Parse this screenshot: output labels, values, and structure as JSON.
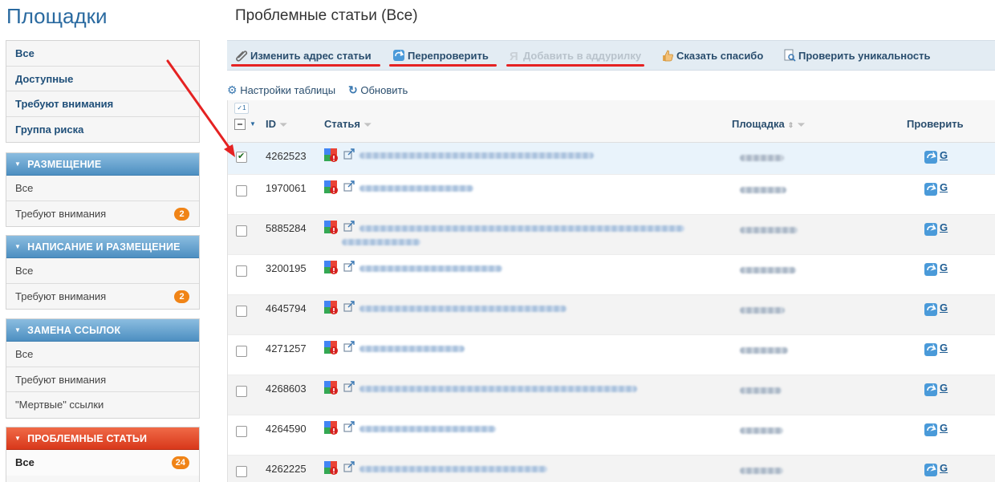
{
  "sidebar": {
    "title": "Площадки",
    "top_items": [
      "Все",
      "Доступные",
      "Требуют внимания",
      "Группа риска"
    ],
    "sections": [
      {
        "title": "РАЗМЕЩЕНИЕ",
        "color": "#5b9ccc",
        "items": [
          {
            "label": "Все"
          },
          {
            "label": "Требуют внимания",
            "badge": "2"
          }
        ]
      },
      {
        "title": "НАПИСАНИЕ И РАЗМЕЩЕНИЕ",
        "color": "#5b9ccc",
        "items": [
          {
            "label": "Все"
          },
          {
            "label": "Требуют внимания",
            "badge": "2"
          }
        ]
      },
      {
        "title": "ЗАМЕНА ССЫЛОК",
        "color": "#5b9ccc",
        "items": [
          {
            "label": "Все"
          },
          {
            "label": "Требуют внимания"
          },
          {
            "label": "\"Мертвые\" ссылки"
          }
        ]
      },
      {
        "title": "ПРОБЛЕМНЫЕ СТАТЬИ",
        "color": "#e04a2a",
        "items": [
          {
            "label": "Все",
            "badge": "24"
          }
        ]
      }
    ]
  },
  "main": {
    "title": "Проблемные статьи (Все)",
    "toolbar": {
      "change_url": "Изменить адрес статьи",
      "recheck": "Перепроверить",
      "add_addurilka": "Добавить в аддурилку",
      "say_thanks": "Сказать спасибо",
      "check_uniqueness": "Проверить уникальность"
    },
    "table_settings": "Настройки таблицы",
    "refresh": "Обновить",
    "columns": {
      "id": "ID",
      "article": "Статья",
      "site": "Площадка",
      "check": "Проверить"
    },
    "selected_count": "1",
    "rows": [
      {
        "id": "4262523",
        "checked": true,
        "g": "G"
      },
      {
        "id": "1970061",
        "checked": false,
        "g": "G"
      },
      {
        "id": "5885284",
        "checked": false,
        "g": "G"
      },
      {
        "id": "3200195",
        "checked": false,
        "g": "G"
      },
      {
        "id": "4645794",
        "checked": false,
        "g": "G"
      },
      {
        "id": "4271257",
        "checked": false,
        "g": "G"
      },
      {
        "id": "4268603",
        "checked": false,
        "g": "G"
      },
      {
        "id": "4264590",
        "checked": false,
        "g": "G"
      },
      {
        "id": "4262225",
        "checked": false,
        "g": "G"
      }
    ]
  },
  "colors": {
    "brand_blue": "#2a6aa0",
    "section_blue": "#5b9ccc",
    "section_red": "#e04a2a",
    "badge_orange": "#f08417",
    "annotation_red": "#e52222"
  }
}
